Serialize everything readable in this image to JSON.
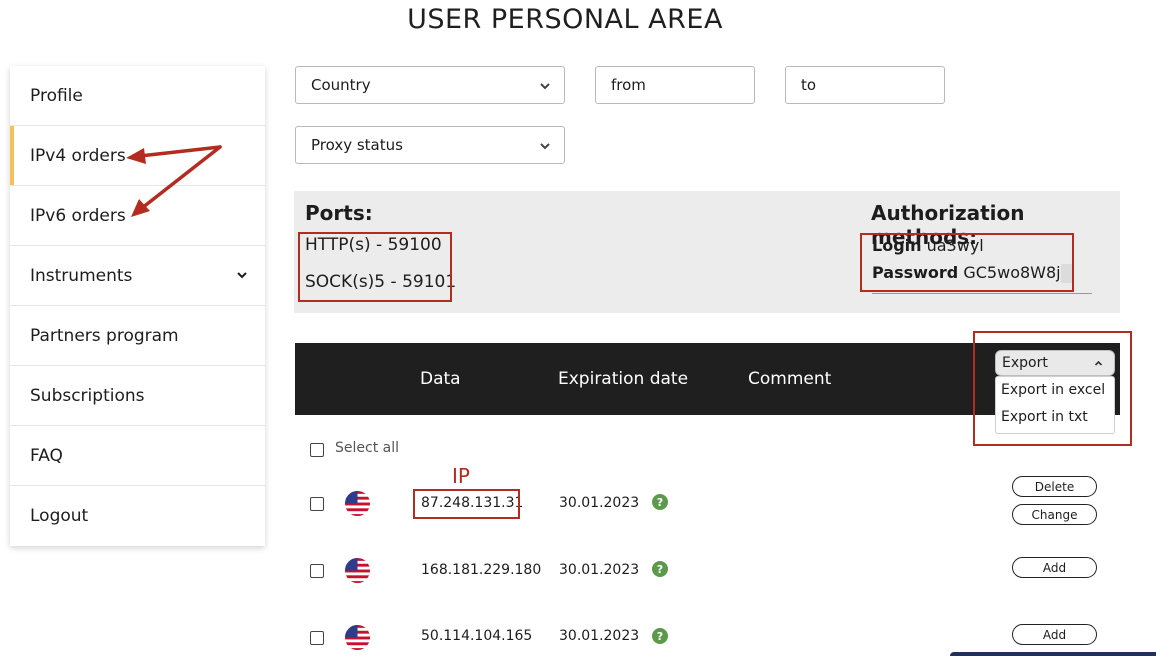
{
  "page": {
    "title": "USER PERSONAL AREA"
  },
  "sidebar": {
    "items": [
      {
        "label": "Profile"
      },
      {
        "label": "IPv4 orders"
      },
      {
        "label": "IPv6 orders"
      },
      {
        "label": "Instruments"
      },
      {
        "label": "Partners program"
      },
      {
        "label": "Subscriptions"
      },
      {
        "label": "FAQ"
      },
      {
        "label": "Logout"
      }
    ]
  },
  "filters": {
    "country": "Country",
    "from_placeholder": "from",
    "to_placeholder": "to",
    "proxy_status": "Proxy status"
  },
  "ports": {
    "heading": "Ports:",
    "http": "HTTP(s) - 59100",
    "socks": "SOCK(s)5 - 59101"
  },
  "auth": {
    "heading": "Authorization methods:",
    "login_label": "Login",
    "login_value": "ua3wyl",
    "password_label": "Password",
    "password_value": "GC5wo8W8j"
  },
  "table": {
    "columns": {
      "data": "Data",
      "expiration": "Expiration date",
      "comment": "Comment"
    },
    "export_label": "Export",
    "export_options": [
      "Export in excel",
      "Export in txt"
    ],
    "select_all": "Select all",
    "rows": [
      {
        "ip": "87.248.131.31",
        "date": "30.01.2023",
        "actions": [
          "Delete",
          "Change"
        ]
      },
      {
        "ip": "168.181.229.180",
        "date": "30.01.2023",
        "actions": [
          "Add"
        ]
      },
      {
        "ip": "50.114.104.165",
        "date": "30.01.2023",
        "actions": [
          "Add"
        ]
      }
    ]
  },
  "annotations": {
    "ip_label": "IP"
  },
  "colors": {
    "accent": "#f4c061",
    "annotation": "#b22c20",
    "header_bg": "#1f1f1f",
    "help_icon": "#5a9a4a"
  }
}
